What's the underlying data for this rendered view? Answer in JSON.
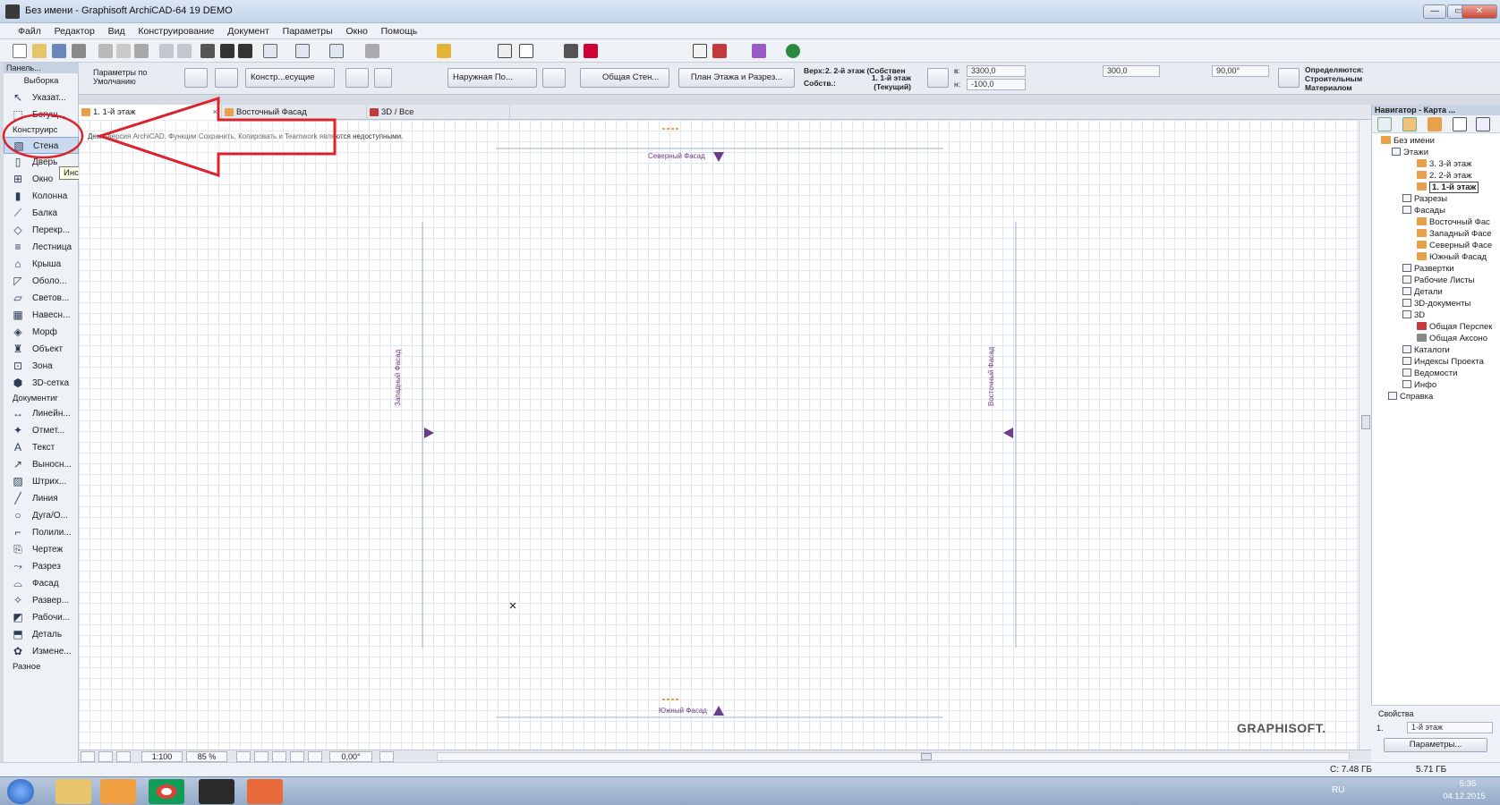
{
  "window": {
    "title": "Без имени - Graphisoft ArchiCAD-64 19 DEMO",
    "minimize": "—",
    "maximize": "▭",
    "close": "✕"
  },
  "menu": [
    "Файл",
    "Редактор",
    "Вид",
    "Конструирование",
    "Документ",
    "Параметры",
    "Окно",
    "Помощь"
  ],
  "infobox": {
    "defaults": "Параметры по Умолчанию",
    "construct": "Констр...есущие",
    "outer": "Наружная По...",
    "general_wall": "Общая Стен...",
    "plan_sect": "План Этажа и Разрез...",
    "top_label": "Верх:",
    "top_value": "2. 2-й этаж (Собствен...",
    "own_label": "Собств.:",
    "own_value": "1. 1-й этаж (Текущий)",
    "h_label": "в:",
    "h_value": "3300,0",
    "n_label": "н:",
    "n_value": "-100,0",
    "thick_value": "300,0",
    "angle_value": "90,00°",
    "material_label": "Определяются: Строительным Материалом"
  },
  "toolbox": {
    "header": "Панель...",
    "select": "Выборка",
    "tools_top": [
      {
        "icon": "↖",
        "label": "Указат..."
      },
      {
        "icon": "⬚",
        "label": "Бегущ..."
      }
    ],
    "group1": "Конструирс",
    "design_tools": [
      {
        "icon": "▧",
        "label": "Стена"
      },
      {
        "icon": "▯",
        "label": "Дверь"
      },
      {
        "icon": "⊞",
        "label": "Окно"
      },
      {
        "icon": "▮",
        "label": "Колонна"
      },
      {
        "icon": "⟋",
        "label": "Балка"
      },
      {
        "icon": "◇",
        "label": "Перекр..."
      },
      {
        "icon": "≡",
        "label": "Лестница"
      },
      {
        "icon": "⌂",
        "label": "Крыша"
      },
      {
        "icon": "◸",
        "label": "Оболо..."
      },
      {
        "icon": "▱",
        "label": "Светов..."
      },
      {
        "icon": "▦",
        "label": "Навесн..."
      },
      {
        "icon": "◈",
        "label": "Морф"
      },
      {
        "icon": "♜",
        "label": "Объект"
      },
      {
        "icon": "⊡",
        "label": "Зона"
      },
      {
        "icon": "⬢",
        "label": "3D-сетка"
      }
    ],
    "group2": "Документиг",
    "doc_tools": [
      {
        "icon": "↔",
        "label": "Линейн..."
      },
      {
        "icon": "✦",
        "label": "Отмет..."
      },
      {
        "icon": "A",
        "label": "Текст"
      },
      {
        "icon": "↗",
        "label": "Выносн..."
      },
      {
        "icon": "▨",
        "label": "Штрих..."
      },
      {
        "icon": "╱",
        "label": "Линия"
      },
      {
        "icon": "○",
        "label": "Дуга/О..."
      },
      {
        "icon": "⌐",
        "label": "Полили..."
      },
      {
        "icon": "⎘",
        "label": "Чертеж"
      },
      {
        "icon": "⤳",
        "label": "Разрез"
      },
      {
        "icon": "⌓",
        "label": "Фасад"
      },
      {
        "icon": "✧",
        "label": "Развер..."
      },
      {
        "icon": "◩",
        "label": "Рабочи..."
      },
      {
        "icon": "⬒",
        "label": "Деталь"
      },
      {
        "icon": "✿",
        "label": "Измене..."
      }
    ],
    "group3": "Разное",
    "tooltip": "Инструмент Стена (Ц)"
  },
  "tabs": [
    {
      "label": "1. 1-й этаж"
    },
    {
      "label": "Восточный Фасад"
    },
    {
      "label": "3D / Все"
    }
  ],
  "canvas": {
    "demo_note": "Демо-версия ArchiCAD. Функции Сохранить, Копировать и Teamwork являются недоступными.",
    "north": "Северный Фасад",
    "south": "Южный Фасад",
    "west": "Западный Фасад",
    "east": "Восточный Фасад",
    "watermark": "GRAPHISOFT."
  },
  "status": {
    "scale": "1:100",
    "zoom": "85 %",
    "angle": "0,00°"
  },
  "navigator": {
    "title": "Навигатор - Карта ...",
    "root": "Без имени",
    "stories": "Этажи",
    "story_list": [
      "3. 3-й этаж",
      "2. 2-й этаж"
    ],
    "current_story": "1. 1-й этаж",
    "sections": "Разрезы",
    "elevations": "Фасады",
    "elevation_list": [
      "Восточный Фас",
      "Западный Фасе",
      "Северный Фасе",
      "Южный Фасад"
    ],
    "others": [
      "Развертки",
      "Рабочие Листы",
      "Детали",
      "3D-документы"
    ],
    "three_d": "3D",
    "three_d_list": [
      "Общая Перспек",
      "Общая Аксоно"
    ],
    "more": [
      "Каталоги",
      "Индексы Проекта",
      "Ведомости",
      "Инфо"
    ],
    "help": "Справка",
    "props_label": "Свойства",
    "props_num": "1.",
    "props_value": "1-й этаж",
    "params_button": "Параметры..."
  },
  "os": {
    "disk_c": "C: 7.48 ГБ",
    "mem": "5.71 ГБ",
    "lang": "RU",
    "time": "5:35",
    "date": "04.12.2015"
  }
}
